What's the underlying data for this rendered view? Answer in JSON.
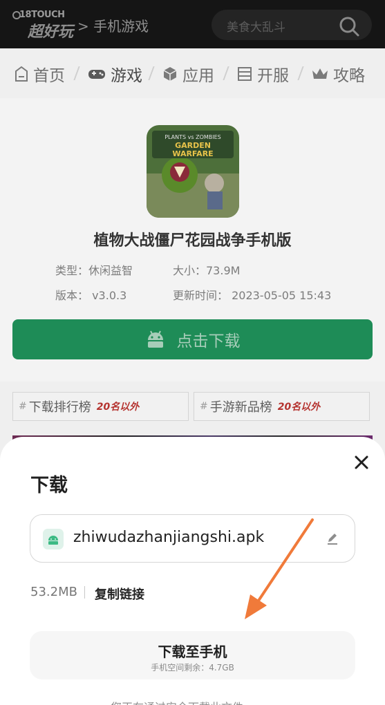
{
  "header": {
    "logo_top": "18TOUCH",
    "logo_bottom": "超好玩",
    "breadcrumb": "> 手机游戏",
    "search_placeholder": "美食大乱斗"
  },
  "nav": {
    "items": [
      {
        "label": "首页",
        "icon": "home-icon"
      },
      {
        "label": "游戏",
        "icon": "gamepad-icon"
      },
      {
        "label": "应用",
        "icon": "cube-icon"
      },
      {
        "label": "开服",
        "icon": "server-icon"
      },
      {
        "label": "攻略",
        "icon": "crown-icon"
      }
    ]
  },
  "app": {
    "title": "植物大战僵尸花园战争手机版",
    "type": "类型：休闲益智",
    "size": "大小：73.9M",
    "version": "版本： v3.0.3",
    "updated": "更新时间： 2023-05-05 15:43",
    "download_label": "点击下载",
    "icon_text": "PLANTS vs ZOMBIES GARDEN WARFARE"
  },
  "rankings": [
    {
      "hash": "#",
      "label": "下载排行榜",
      "tag": "20名以外"
    },
    {
      "hash": "#",
      "label": "手游新品榜",
      "tag": "20名以外"
    }
  ],
  "sheet": {
    "title": "下载",
    "file_name": "zhiwudazhanjiangshi.apk",
    "file_size": "53.2MB",
    "copy_link": "复制链接",
    "download_to_phone": "下载至手机",
    "space_remaining": "手机空间剩余：4.7GB",
    "bottom_text": "您正在通过安全下载此文件"
  },
  "colors": {
    "accent_green": "#1e8c57",
    "arrow_orange": "#f07a3a",
    "rank_tag_red": "#b5332f"
  }
}
